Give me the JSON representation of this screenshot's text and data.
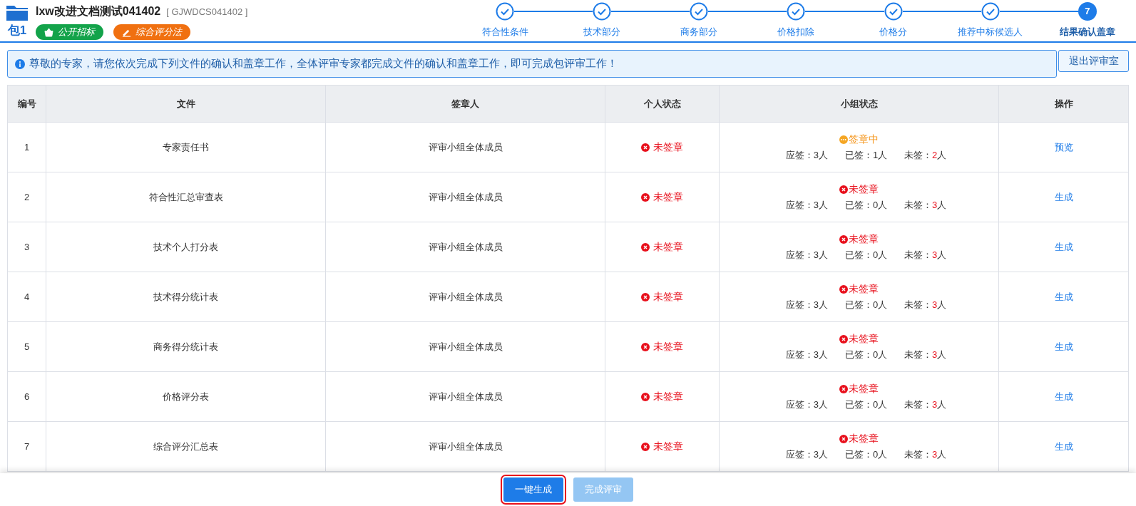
{
  "header": {
    "title": "lxw改进文档测试041402",
    "code": "[ GJWDCS041402 ]",
    "package": "包1",
    "tags": [
      {
        "kind": "bidding",
        "label": "公开招标",
        "color": "#13a34a"
      },
      {
        "kind": "method",
        "label": "综合评分法",
        "color": "#f07010"
      }
    ]
  },
  "steps": [
    {
      "label": "符合性条件",
      "done": true,
      "selected": false
    },
    {
      "label": "技术部分",
      "done": true,
      "selected": false
    },
    {
      "label": "商务部分",
      "done": true,
      "selected": false
    },
    {
      "label": "价格扣除",
      "done": true,
      "selected": false
    },
    {
      "label": "价格分",
      "done": true,
      "selected": false
    },
    {
      "label": "推荐中标候选人",
      "done": true,
      "selected": false
    },
    {
      "label": "结果确认盖章",
      "done": false,
      "selected": true,
      "number": "7"
    }
  ],
  "notice": "尊敬的专家，请您依次完成下列文件的确认和盖章工作，全体评审专家都完成文件的确认和盖章工作，即可完成包评审工作！",
  "exit_button": "退出评审室",
  "table": {
    "columns": [
      "编号",
      "文件",
      "签章人",
      "个人状态",
      "小组状态",
      "操作"
    ],
    "rows": [
      {
        "no": "1",
        "file": "专家责任书",
        "signer": "评审小组全体成员",
        "personal": {
          "kind": "unsigned",
          "label": "未签章"
        },
        "group": {
          "kind": "signing",
          "label": "签章中"
        },
        "counts": [
          {
            "label": "应签：",
            "number": "3",
            "unit": "人",
            "highlight": false
          },
          {
            "label": "已签：",
            "number": "1",
            "unit": "人",
            "highlight": false
          },
          {
            "label": "未签：",
            "number": "2",
            "unit": "人",
            "highlight": true
          }
        ],
        "action": "预览"
      },
      {
        "no": "2",
        "file": "符合性汇总审查表",
        "signer": "评审小组全体成员",
        "personal": {
          "kind": "unsigned",
          "label": "未签章"
        },
        "group": {
          "kind": "unsigned",
          "label": "未签章"
        },
        "counts": [
          {
            "label": "应签：",
            "number": "3",
            "unit": "人",
            "highlight": false
          },
          {
            "label": "已签：",
            "number": "0",
            "unit": "人",
            "highlight": false
          },
          {
            "label": "未签：",
            "number": "3",
            "unit": "人",
            "highlight": true
          }
        ],
        "action": "生成"
      },
      {
        "no": "3",
        "file": "技术个人打分表",
        "signer": "评审小组全体成员",
        "personal": {
          "kind": "unsigned",
          "label": "未签章"
        },
        "group": {
          "kind": "unsigned",
          "label": "未签章"
        },
        "counts": [
          {
            "label": "应签：",
            "number": "3",
            "unit": "人",
            "highlight": false
          },
          {
            "label": "已签：",
            "number": "0",
            "unit": "人",
            "highlight": false
          },
          {
            "label": "未签：",
            "number": "3",
            "unit": "人",
            "highlight": true
          }
        ],
        "action": "生成"
      },
      {
        "no": "4",
        "file": "技术得分统计表",
        "signer": "评审小组全体成员",
        "personal": {
          "kind": "unsigned",
          "label": "未签章"
        },
        "group": {
          "kind": "unsigned",
          "label": "未签章"
        },
        "counts": [
          {
            "label": "应签：",
            "number": "3",
            "unit": "人",
            "highlight": false
          },
          {
            "label": "已签：",
            "number": "0",
            "unit": "人",
            "highlight": false
          },
          {
            "label": "未签：",
            "number": "3",
            "unit": "人",
            "highlight": true
          }
        ],
        "action": "生成"
      },
      {
        "no": "5",
        "file": "商务得分统计表",
        "signer": "评审小组全体成员",
        "personal": {
          "kind": "unsigned",
          "label": "未签章"
        },
        "group": {
          "kind": "unsigned",
          "label": "未签章"
        },
        "counts": [
          {
            "label": "应签：",
            "number": "3",
            "unit": "人",
            "highlight": false
          },
          {
            "label": "已签：",
            "number": "0",
            "unit": "人",
            "highlight": false
          },
          {
            "label": "未签：",
            "number": "3",
            "unit": "人",
            "highlight": true
          }
        ],
        "action": "生成"
      },
      {
        "no": "6",
        "file": "价格评分表",
        "signer": "评审小组全体成员",
        "personal": {
          "kind": "unsigned",
          "label": "未签章"
        },
        "group": {
          "kind": "unsigned",
          "label": "未签章"
        },
        "counts": [
          {
            "label": "应签：",
            "number": "3",
            "unit": "人",
            "highlight": false
          },
          {
            "label": "已签：",
            "number": "0",
            "unit": "人",
            "highlight": false
          },
          {
            "label": "未签：",
            "number": "3",
            "unit": "人",
            "highlight": true
          }
        ],
        "action": "生成"
      },
      {
        "no": "7",
        "file": "综合评分汇总表",
        "signer": "评审小组全体成员",
        "personal": {
          "kind": "unsigned",
          "label": "未签章"
        },
        "group": {
          "kind": "unsigned",
          "label": "未签章"
        },
        "counts": [
          {
            "label": "应签：",
            "number": "3",
            "unit": "人",
            "highlight": false
          },
          {
            "label": "已签：",
            "number": "0",
            "unit": "人",
            "highlight": false
          },
          {
            "label": "未签：",
            "number": "3",
            "unit": "人",
            "highlight": true
          }
        ],
        "action": "生成"
      }
    ]
  },
  "footer": {
    "buttons": [
      {
        "label": "一键生成",
        "disabled": false,
        "selected": true
      },
      {
        "label": "完成评审",
        "disabled": true,
        "selected": false
      }
    ]
  }
}
